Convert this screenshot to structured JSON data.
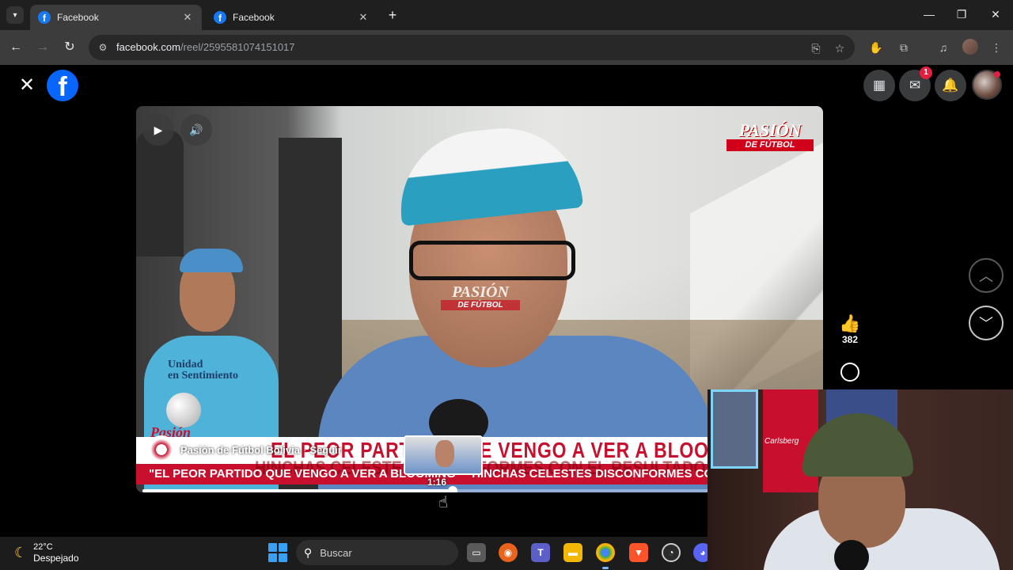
{
  "browser": {
    "tabs": [
      {
        "title": "Facebook",
        "active": true
      },
      {
        "title": "Facebook",
        "active": false
      }
    ],
    "new_tab_icon": "plus-icon",
    "window_controls": [
      "minimize-icon",
      "restore-icon",
      "close-icon"
    ],
    "url_host": "facebook.com",
    "url_path": "/reel/2595581074151017"
  },
  "facebook": {
    "notifications_badge": "1",
    "top_icons": [
      "menu-grid-icon",
      "messenger-icon",
      "bell-icon"
    ]
  },
  "video": {
    "brand_top": "PASIÓN",
    "brand_sub": "DE FÚTBOL",
    "lower_third": "EL PEOR PARTIDO QUE VENGO A VER A BLOOMING",
    "ticker": "\"EL PEOR PARTIDO QUE VENGO A VER A BLOOMING\" - HINCHAS CELESTES DISCONFORMES CON EL RESULTADO",
    "ticker_overlay": "HINCHAS CELESTES DISCONFORMES CON EL RESULTADO",
    "shirt_text": "Unidad\nen Sentimiento",
    "logo_label": "Pasión",
    "page_name": "Pasión de Fútbol Bolivia",
    "page_separator": "·",
    "follow_label": "Seguir",
    "hover_time": "1:16",
    "progress_fraction": 0.46
  },
  "reactions": {
    "like_count": "382"
  },
  "webcam": {
    "jersey_label": "Carlsberg"
  },
  "taskbar": {
    "weather_temp": "22°C",
    "weather_desc": "Despejado",
    "search_placeholder": "Buscar"
  },
  "colors": {
    "fb_blue": "#0866ff",
    "notification_red": "#e41e3f",
    "brand_red": "#c8102e"
  }
}
